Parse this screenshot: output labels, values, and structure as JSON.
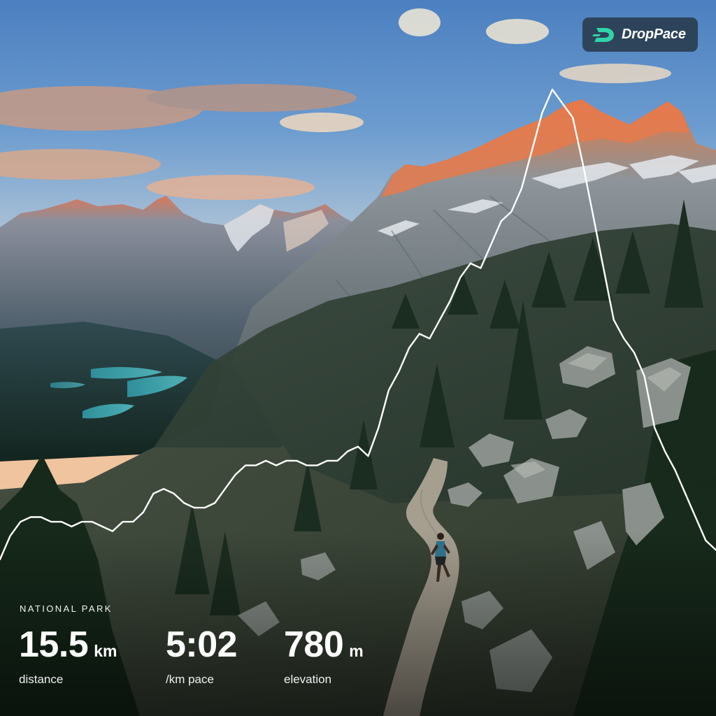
{
  "brand": {
    "name": "DropPace",
    "logo_icon": "droppace-d-logo-icon",
    "accent": "#2fd4a8"
  },
  "location_label": "NATIONAL PARK",
  "stats": [
    {
      "key": "distance",
      "value": "15.5",
      "unit": "km",
      "label": "distance"
    },
    {
      "key": "pace",
      "value": "5:02",
      "unit": "",
      "label": "/km pace"
    },
    {
      "key": "elevation",
      "value": "780",
      "unit": "m",
      "label": "elevation"
    }
  ],
  "elevation_profile": {
    "line_color": "#ffffff",
    "relative_elevation": [
      0.0,
      0.05,
      0.08,
      0.09,
      0.09,
      0.08,
      0.08,
      0.07,
      0.08,
      0.08,
      0.07,
      0.06,
      0.08,
      0.08,
      0.1,
      0.14,
      0.15,
      0.14,
      0.12,
      0.11,
      0.11,
      0.12,
      0.15,
      0.18,
      0.2,
      0.2,
      0.21,
      0.2,
      0.21,
      0.21,
      0.2,
      0.2,
      0.21,
      0.21,
      0.23,
      0.24,
      0.22,
      0.28,
      0.36,
      0.4,
      0.45,
      0.48,
      0.47,
      0.51,
      0.55,
      0.6,
      0.63,
      0.62,
      0.67,
      0.72,
      0.74,
      0.79,
      0.87,
      0.95,
      1.0,
      0.97,
      0.94,
      0.84,
      0.73,
      0.62,
      0.51,
      0.47,
      0.44,
      0.39,
      0.28,
      0.23,
      0.19,
      0.14,
      0.09,
      0.04,
      0.02
    ]
  }
}
